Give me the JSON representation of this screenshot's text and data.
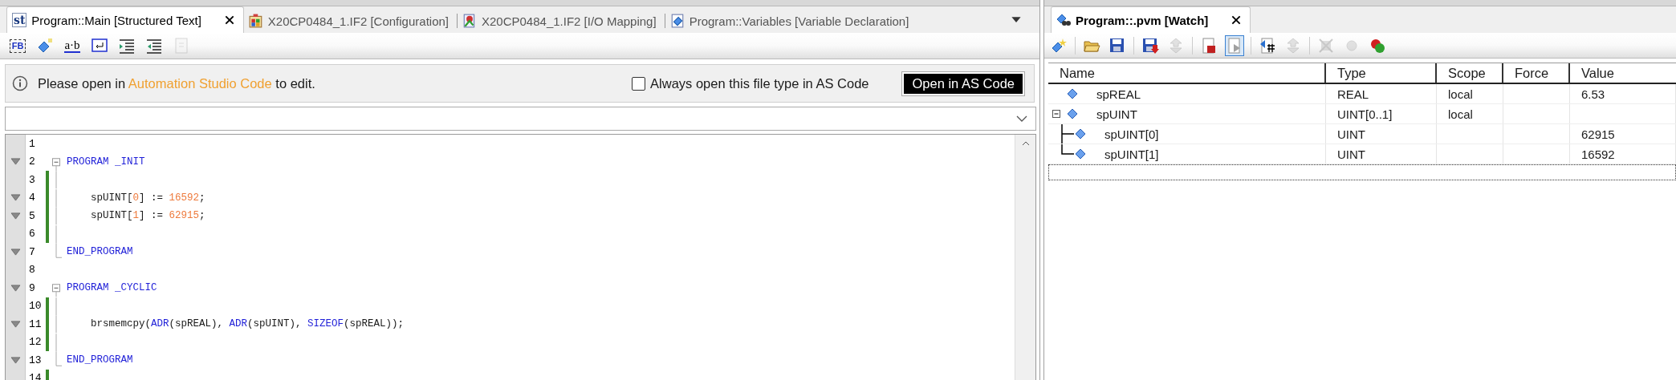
{
  "editor_tabs": [
    {
      "kind": "st",
      "label": "Program::Main [Structured Text]",
      "icon_text": "st",
      "selected": true
    },
    {
      "kind": "config",
      "label": "X20CP0484_1.IF2 [Configuration]",
      "selected": false
    },
    {
      "kind": "mapping",
      "label": "X20CP0484_1.IF2 [I/O Mapping]",
      "selected": false
    },
    {
      "kind": "variables",
      "label": "Program::Variables [Variable Declaration]",
      "selected": false
    }
  ],
  "editor_toolbar": [
    {
      "kind": "fb",
      "text": "FB",
      "disabled": false
    },
    {
      "kind": "diamond",
      "disabled": false
    },
    {
      "kind": "ab",
      "text": "a·b",
      "disabled": false
    },
    {
      "kind": "wrap",
      "disabled": false
    },
    {
      "kind": "indent",
      "disabled": false
    },
    {
      "kind": "outdent",
      "disabled": false
    },
    {
      "kind": "page",
      "disabled": true
    }
  ],
  "info_bar": {
    "text_before": "Please open in ",
    "link": "Automation Studio Code",
    "text_after": " to edit.",
    "checkbox": {
      "label": "Always open this file type in AS Code",
      "checked": false
    },
    "button": "Open in AS Code"
  },
  "code_lines": [
    {
      "number": "1",
      "marker": false,
      "changed": false,
      "kind": "plain"
    },
    {
      "number": "2",
      "marker": true,
      "changed": false,
      "kind": "fold-start",
      "tokens": [
        {
          "kind": "keyword",
          "text": "PROGRAM _INIT"
        }
      ]
    },
    {
      "number": "3",
      "marker": false,
      "changed": true,
      "kind": "fold-body"
    },
    {
      "number": "4",
      "marker": true,
      "changed": true,
      "kind": "fold-body",
      "tokens": [
        {
          "kind": "plain",
          "text": "    spUINT["
        },
        {
          "kind": "number",
          "text": "0"
        },
        {
          "kind": "plain",
          "text": "] := "
        },
        {
          "kind": "number",
          "text": "16592"
        },
        {
          "kind": "plain",
          "text": ";"
        }
      ]
    },
    {
      "number": "5",
      "marker": true,
      "changed": true,
      "kind": "fold-body",
      "tokens": [
        {
          "kind": "plain",
          "text": "    spUINT["
        },
        {
          "kind": "number",
          "text": "1"
        },
        {
          "kind": "plain",
          "text": "] := "
        },
        {
          "kind": "number",
          "text": "62915"
        },
        {
          "kind": "plain",
          "text": ";"
        }
      ]
    },
    {
      "number": "6",
      "marker": false,
      "changed": true,
      "kind": "fold-body"
    },
    {
      "number": "7",
      "marker": true,
      "changed": false,
      "kind": "fold-end",
      "tokens": [
        {
          "kind": "keyword",
          "text": "END_PROGRAM"
        }
      ]
    },
    {
      "number": "8",
      "marker": false,
      "changed": false,
      "kind": "plain"
    },
    {
      "number": "9",
      "marker": true,
      "changed": false,
      "kind": "fold-start",
      "tokens": [
        {
          "kind": "keyword",
          "text": "PROGRAM _CYCLIC"
        }
      ]
    },
    {
      "number": "10",
      "marker": false,
      "changed": true,
      "kind": "fold-body"
    },
    {
      "number": "11",
      "marker": true,
      "changed": true,
      "kind": "fold-body",
      "tokens": [
        {
          "kind": "plain",
          "text": "    brsmemcpy("
        },
        {
          "kind": "keyword",
          "text": "ADR"
        },
        {
          "kind": "plain",
          "text": "(spREAL), "
        },
        {
          "kind": "keyword",
          "text": "ADR"
        },
        {
          "kind": "plain",
          "text": "(spUINT), "
        },
        {
          "kind": "keyword",
          "text": "SIZEOF"
        },
        {
          "kind": "plain",
          "text": "(spREAL));"
        }
      ]
    },
    {
      "number": "12",
      "marker": false,
      "changed": true,
      "kind": "fold-body"
    },
    {
      "number": "13",
      "marker": true,
      "changed": false,
      "kind": "fold-end",
      "tokens": [
        {
          "kind": "keyword",
          "text": "END_PROGRAM"
        }
      ]
    },
    {
      "number": "14",
      "marker": false,
      "changed": true,
      "kind": "plain"
    }
  ],
  "watch": {
    "tab": {
      "label": "Program::.pvm [Watch]",
      "selected": true
    },
    "toolbar": [
      {
        "kind": "new",
        "pressed": false,
        "disabled": false
      },
      {
        "kind": "open",
        "pressed": false,
        "disabled": false
      },
      {
        "kind": "save",
        "pressed": false,
        "disabled": false
      },
      {
        "kind": "save-down",
        "pressed": false,
        "disabled": false
      },
      {
        "kind": "arrows",
        "pressed": false,
        "disabled": true
      },
      {
        "kind": "stop-page",
        "pressed": false,
        "disabled": false
      },
      {
        "kind": "play-page",
        "pressed": true,
        "disabled": false
      },
      {
        "kind": "refresh",
        "pressed": false,
        "disabled": false
      },
      {
        "kind": "step",
        "pressed": false,
        "disabled": true
      },
      {
        "kind": "cross",
        "pressed": false,
        "disabled": true
      },
      {
        "kind": "dot",
        "pressed": false,
        "disabled": true
      },
      {
        "kind": "balls",
        "pressed": false,
        "disabled": false
      }
    ],
    "columns": [
      "Name",
      "Type",
      "Scope",
      "Force",
      "Value"
    ],
    "rows": [
      {
        "name": "spREAL",
        "type": "REAL",
        "scope": "local",
        "value": "6.53"
      },
      {
        "name": "spUINT",
        "type": "UINT[0..1]",
        "scope": "local",
        "expanded": true,
        "children": [
          {
            "name": "spUINT[0]",
            "type": "UINT",
            "value": "62915"
          },
          {
            "name": "spUINT[1]",
            "type": "UINT",
            "value": "16592"
          }
        ]
      }
    ]
  }
}
